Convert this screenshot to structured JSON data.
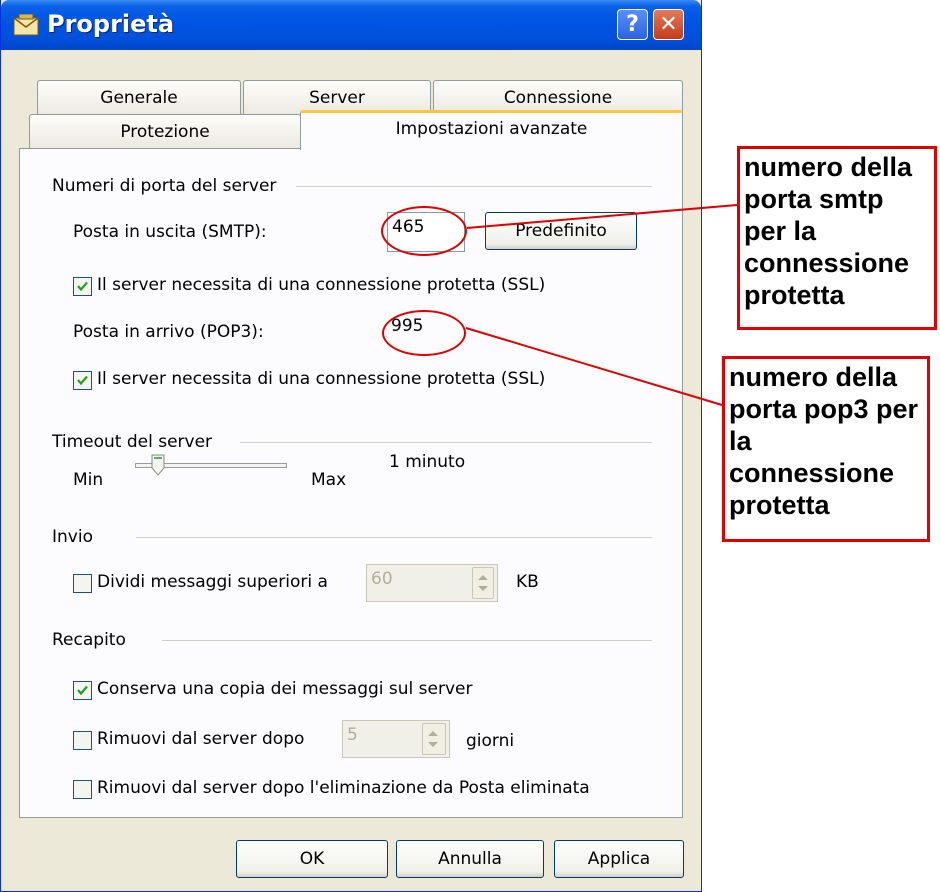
{
  "window": {
    "title": "Proprietà",
    "help_label": "?",
    "close_label": "✕"
  },
  "tabs": [
    {
      "label": "Generale",
      "active": false
    },
    {
      "label": "Server",
      "active": false
    },
    {
      "label": "Connessione",
      "active": false
    },
    {
      "label": "Protezione",
      "active": false
    },
    {
      "label": "Impostazioni avanzate",
      "active": true
    }
  ],
  "ports": {
    "group_label": "Numeri di porta del server",
    "smtp_label": "Posta in uscita (SMTP):",
    "smtp_value": "465",
    "default_button": "Predefinito",
    "ssl_smtp_label": "Il server necessita di una connessione protetta (SSL)",
    "ssl_smtp_checked": true,
    "pop3_label": "Posta in arrivo (POP3):",
    "pop3_value": "995",
    "ssl_pop3_label": "Il server necessita di una connessione protetta (SSL)",
    "ssl_pop3_checked": true
  },
  "timeout": {
    "group_label": "Timeout del server",
    "min_label": "Min",
    "max_label": "Max",
    "value_label": "1 minuto",
    "slider_level": 0.15
  },
  "send": {
    "group_label": "Invio",
    "split_label": "Dividi messaggi superiori a",
    "split_checked": false,
    "split_value": "60",
    "unit_label": "KB"
  },
  "delivery": {
    "group_label": "Recapito",
    "keep_copy_label": "Conserva una copia dei messaggi sul server",
    "keep_copy_checked": true,
    "remove_after_label": "Rimuovi dal server dopo",
    "remove_after_checked": false,
    "remove_after_value": "5",
    "days_label": "giorni",
    "remove_deleted_label": "Rimuovi dal server dopo l'eliminazione da Posta eliminata",
    "remove_deleted_checked": false
  },
  "footer": {
    "ok_label": "OK",
    "cancel_label": "Annulla",
    "apply_label": "Applica"
  },
  "annotations": {
    "smtp_callout": "numero della porta smtp per la connessione protetta",
    "pop3_callout": "numero della porta pop3 per la connessione protetta",
    "highlight_color": "#E00000"
  },
  "colors": {
    "titlebar": "#0054E3",
    "dialog_bg": "#ECE9D8",
    "active_tab_accent": "#FFC83C"
  }
}
